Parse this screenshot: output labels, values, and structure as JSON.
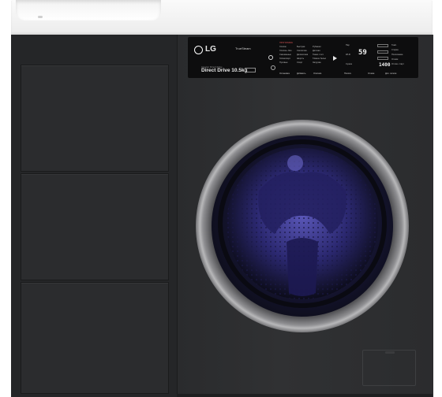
{
  "brand": "LG",
  "steam_badge": "TrueSteam",
  "model_line_small": "Inverter Direct Drive",
  "model_line": "Direct Drive 10.5kg",
  "programs_header": "ПРОГРАММЫ",
  "programs": [
    "Хлопок",
    "Хлопок+ Эко",
    "Смешанные",
    "Гипоаллерг.",
    "Пуховые",
    "Быстрая",
    "Синтетика",
    "Деликатная",
    "Шерсть",
    "Спорт",
    "Рубашки",
    "Детская",
    "Ткани с пит.",
    "Тёмное бельё",
    "Загрузка"
  ],
  "panel_buttons": [
    "Остановка",
    "Добавить",
    "Ополаск.",
    "Полоск.",
    "Отжим",
    "Доп. полоск."
  ],
  "display_time": "59",
  "display_rpm": "1400",
  "options": [
    "Темп.",
    "Стирка",
    "Полоскание",
    "Отжим",
    "Отлож. старт",
    "Сушка",
    "Пар",
    "Wi-Fi"
  ],
  "colors": {
    "cabinet": "#252628",
    "washer_body": "#2e2f31",
    "panel": "#0d0d0e",
    "door_glass": "#2a2758",
    "countertop": "#f3f3f3"
  }
}
